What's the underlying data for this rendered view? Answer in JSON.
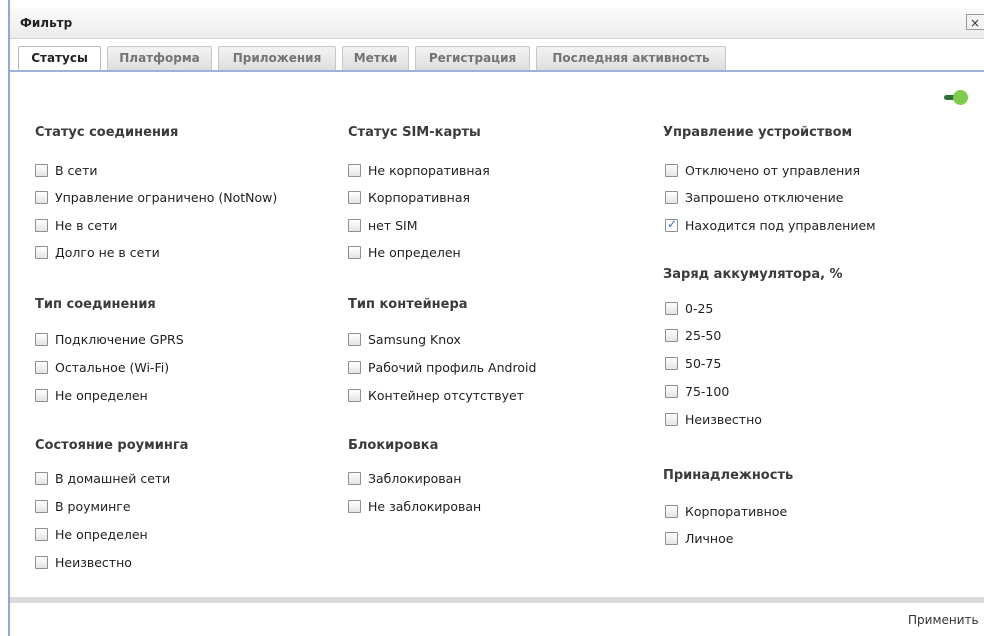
{
  "window": {
    "title": "Фильтр",
    "close_label": "×"
  },
  "tabs": [
    {
      "label": "Статусы",
      "active": true
    },
    {
      "label": "Платформа",
      "active": false
    },
    {
      "label": "Приложения",
      "active": false
    },
    {
      "label": "Метки",
      "active": false
    },
    {
      "label": "Регистрация",
      "active": false
    },
    {
      "label": "Последняя активность",
      "active": false
    }
  ],
  "toggle": {
    "on": true
  },
  "sections": {
    "connection_status": {
      "title": "Статус соединения",
      "options": [
        {
          "label": "В сети",
          "checked": false
        },
        {
          "label": "Управление ограничено (NotNow)",
          "checked": false
        },
        {
          "label": "Не в сети",
          "checked": false
        },
        {
          "label": "Долго не в сети",
          "checked": false
        }
      ]
    },
    "connection_type": {
      "title": "Тип соединения",
      "options": [
        {
          "label": "Подключение GPRS",
          "checked": false
        },
        {
          "label": "Остальное (Wi-Fi)",
          "checked": false
        },
        {
          "label": "Не определен",
          "checked": false
        }
      ]
    },
    "roaming": {
      "title": "Состояние роуминга",
      "options": [
        {
          "label": "В домашней сети",
          "checked": false
        },
        {
          "label": "В роуминге",
          "checked": false
        },
        {
          "label": "Не определен",
          "checked": false
        },
        {
          "label": "Неизвестно",
          "checked": false
        }
      ]
    },
    "sim_status": {
      "title": "Статус SIM-карты",
      "options": [
        {
          "label": "Не корпоративная",
          "checked": false
        },
        {
          "label": "Корпоративная",
          "checked": false
        },
        {
          "label": "нет SIM",
          "checked": false
        },
        {
          "label": "Не определен",
          "checked": false
        }
      ]
    },
    "container_type": {
      "title": "Тип контейнера",
      "options": [
        {
          "label": "Samsung Knox",
          "checked": false
        },
        {
          "label": "Рабочий профиль Android",
          "checked": false
        },
        {
          "label": "Контейнер отсутствует",
          "checked": false
        }
      ]
    },
    "lock": {
      "title": "Блокировка",
      "options": [
        {
          "label": "Заблокирован",
          "checked": false
        },
        {
          "label": "Не заблокирован",
          "checked": false
        }
      ]
    },
    "device_management": {
      "title": "Управление устройством",
      "options": [
        {
          "label": "Отключено от управления",
          "checked": false
        },
        {
          "label": "Запрошено отключение",
          "checked": false
        },
        {
          "label": "Находится под управлением",
          "checked": true
        }
      ]
    },
    "battery": {
      "title": "Заряд аккумулятора, %",
      "options": [
        {
          "label": "0-25",
          "checked": false
        },
        {
          "label": "25-50",
          "checked": false
        },
        {
          "label": "50-75",
          "checked": false
        },
        {
          "label": "75-100",
          "checked": false
        },
        {
          "label": "Неизвестно",
          "checked": false
        }
      ]
    },
    "ownership": {
      "title": "Принадлежность",
      "options": [
        {
          "label": "Корпоративное",
          "checked": false
        },
        {
          "label": "Личное",
          "checked": false
        }
      ]
    }
  },
  "footer": {
    "apply_label": "Применить"
  }
}
